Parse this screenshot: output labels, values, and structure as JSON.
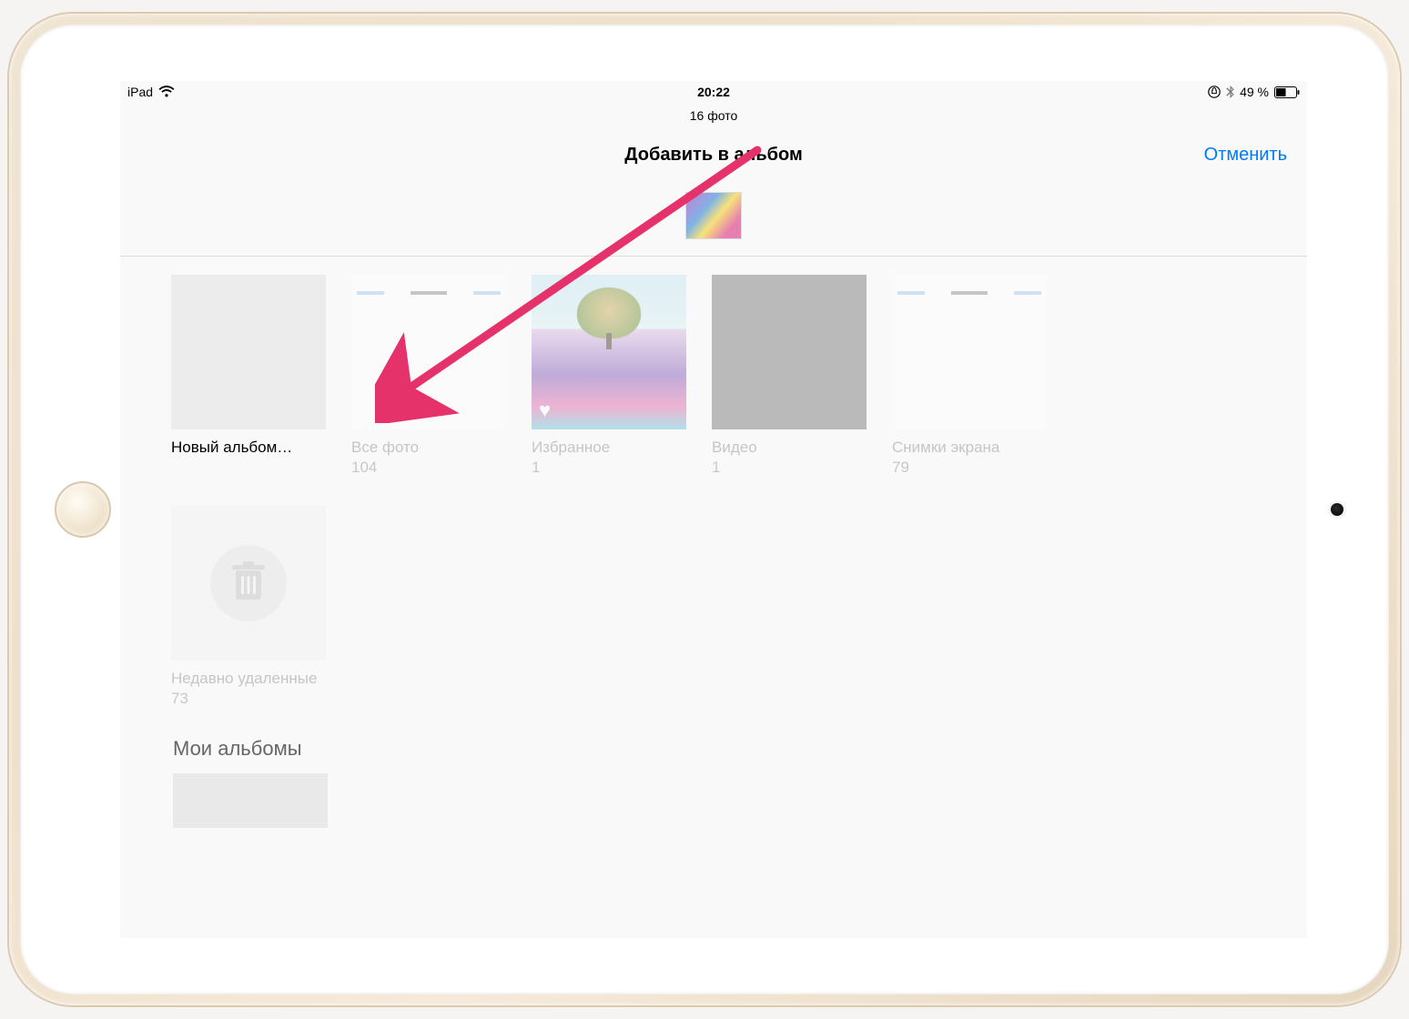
{
  "statusbar": {
    "device": "iPad",
    "time": "20:22",
    "battery_text": "49 %"
  },
  "header": {
    "subtitle": "16 фото",
    "title": "Добавить в альбом",
    "cancel": "Отменить"
  },
  "albums": {
    "new_label": "Новый альбом…",
    "all": {
      "name": "Все фото",
      "count": "104"
    },
    "fav": {
      "name": "Избранное",
      "count": "1"
    },
    "video": {
      "name": "Видео",
      "count": "1"
    },
    "screenshots": {
      "name": "Снимки экрана",
      "count": "79"
    },
    "deleted": {
      "name": "Недавно удаленные",
      "count": "73"
    }
  },
  "section": {
    "my_albums": "Мои альбомы"
  },
  "annotation": {
    "arrow_color": "#e6326b"
  }
}
